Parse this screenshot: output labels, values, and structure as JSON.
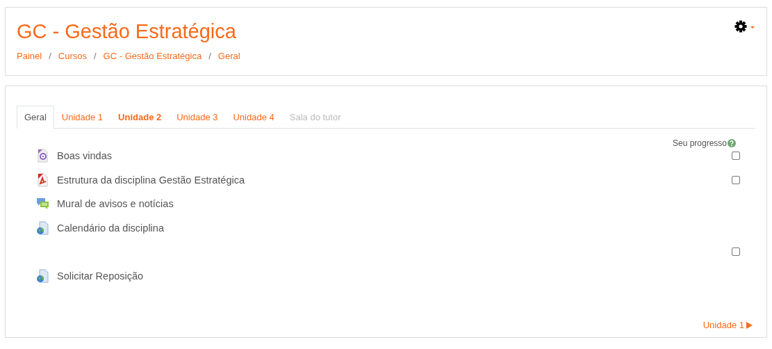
{
  "header": {
    "title": "GC - Gestão Estratégica",
    "separator": "/",
    "breadcrumb": [
      "Painel",
      "Cursos",
      "GC - Gestão Estratégica",
      "Geral"
    ]
  },
  "tabs": [
    {
      "label": "Geral",
      "selected": true,
      "current": false,
      "disabled": false
    },
    {
      "label": "Unidade 1",
      "selected": false,
      "current": false,
      "disabled": false
    },
    {
      "label": "Unidade 2",
      "selected": false,
      "current": true,
      "disabled": false
    },
    {
      "label": "Unidade 3",
      "selected": false,
      "current": false,
      "disabled": false
    },
    {
      "label": "Unidade 4",
      "selected": false,
      "current": false,
      "disabled": false
    },
    {
      "label": "Sala do tutor",
      "selected": false,
      "current": false,
      "disabled": true
    }
  ],
  "progress_label": "Seu progresso",
  "activities": [
    {
      "kind": "video",
      "name": "Boas vindas",
      "completion": {
        "checked": false
      }
    },
    {
      "kind": "pdf",
      "name": "Estrutura da disciplina Gestão Estratégica",
      "completion": {
        "checked": false
      }
    },
    {
      "kind": "forum",
      "name": "Mural de avisos e notícias"
    },
    {
      "kind": "url",
      "name": "Calendário da disciplina"
    },
    {
      "kind": "label",
      "completion": {
        "checked": false
      }
    },
    {
      "kind": "url",
      "name": "Solicitar Reposição"
    }
  ],
  "next_link": "Unidade 1"
}
